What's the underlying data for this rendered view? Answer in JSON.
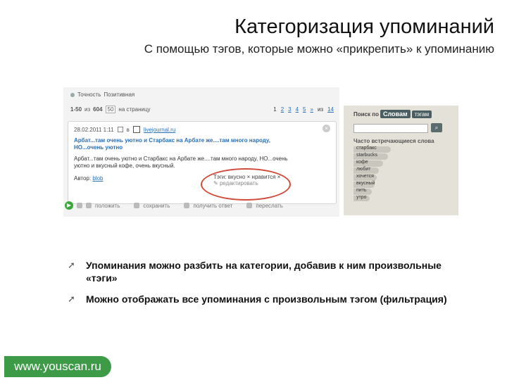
{
  "slide": {
    "title": "Категоризация упоминаний",
    "subtitle": "С помощью тэгов, которые можно «прикрепить» к упоминанию"
  },
  "panel": {
    "filter_label": "Точность",
    "filter_value": "Позитивная",
    "range": "1-50",
    "of_label": "из",
    "total": "604",
    "per_page": "50",
    "per_page_suffix": "на страницу",
    "pages": [
      "1",
      "2",
      "3",
      "4",
      "5",
      "»",
      "14"
    ],
    "of_pages_label": "из"
  },
  "mention": {
    "date": "28.02.2011 1:11",
    "source_label": "в",
    "source": "livejournal.ru",
    "headline": "Арбат...там очень уютно и Старбакс на Арбате же....там много народу, НО...очень уютно",
    "body": "Арбат...там очень уютно и Старбакс на Арбате же....там много народу, НО...очень уютно и вкусный кофе, очень вкусный.",
    "author_label": "Автор:",
    "author": "blob",
    "tags_line": "Тэги: вкусно  ×   нравится  ×",
    "edit_tags": "редактировать"
  },
  "actions": [
    "положить",
    "сохранить",
    "получить ответ",
    "переслать"
  ],
  "sidebar": {
    "search_by": "Поиск по",
    "tab_words": "Словам",
    "tab_tags": "тэгам",
    "search_button": "⌕",
    "often_label": "Часто встречающиеся слова",
    "tags": [
      {
        "label": "старбакс",
        "weight": 0.88
      },
      {
        "label": "starbucks",
        "weight": 0.82
      },
      {
        "label": "кофе",
        "weight": 0.7
      },
      {
        "label": "любит",
        "weight": 0.6
      },
      {
        "label": "хочется",
        "weight": 0.55
      },
      {
        "label": "вкусный",
        "weight": 0.5
      },
      {
        "label": "пить",
        "weight": 0.44
      },
      {
        "label": "утро",
        "weight": 0.38
      }
    ]
  },
  "bullets": [
    "Упоминания можно разбить на категории, добавив к ним произвольные «тэги»",
    "Можно отображать все упоминания с произвольным тэгом (фильтрация)"
  ],
  "logo": "www.youscan.ru",
  "colors": {
    "accent_red": "#d24a3a",
    "logo_green": "#3d9b47",
    "link_blue": "#2b6fb5"
  }
}
